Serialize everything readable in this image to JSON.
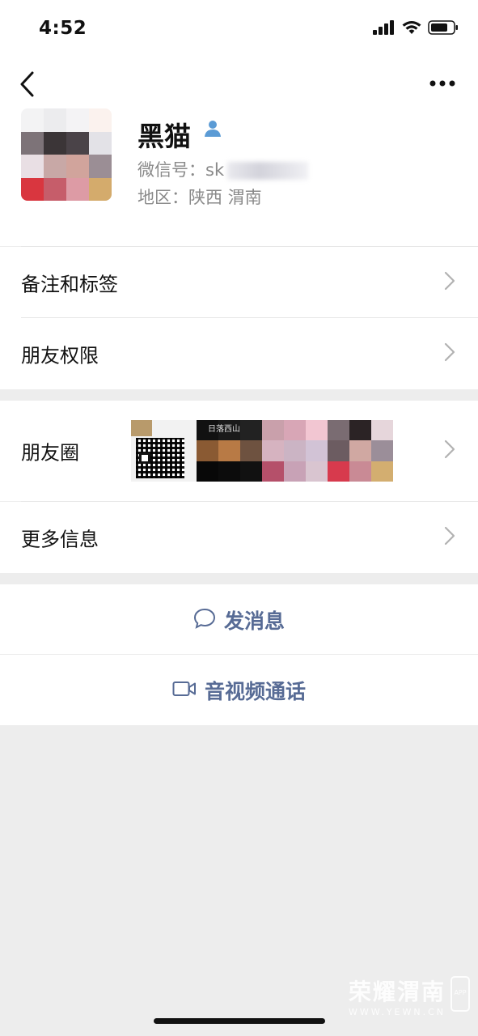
{
  "status_bar": {
    "time": "4:52"
  },
  "profile": {
    "name": "黑猫",
    "wechat_id_label": "微信号：",
    "wechat_id_value": "sk",
    "region": "地区：陕西 渭南"
  },
  "menu": {
    "remarks_tags": "备注和标签",
    "friend_permissions": "朋友权限",
    "moments": "朋友圈",
    "more_info": "更多信息"
  },
  "actions": {
    "send_message": "发消息",
    "video_call": "音视频通话"
  },
  "moments_thumbs": {
    "thumb2_text": "日落西山"
  },
  "watermark": {
    "title": "荣耀渭南",
    "url": "WWW.YEWN.CN",
    "badge": "APP"
  },
  "colors": {
    "link_blue": "#576b95",
    "accent_person": "#5b9bd5",
    "background": "#ededed"
  }
}
